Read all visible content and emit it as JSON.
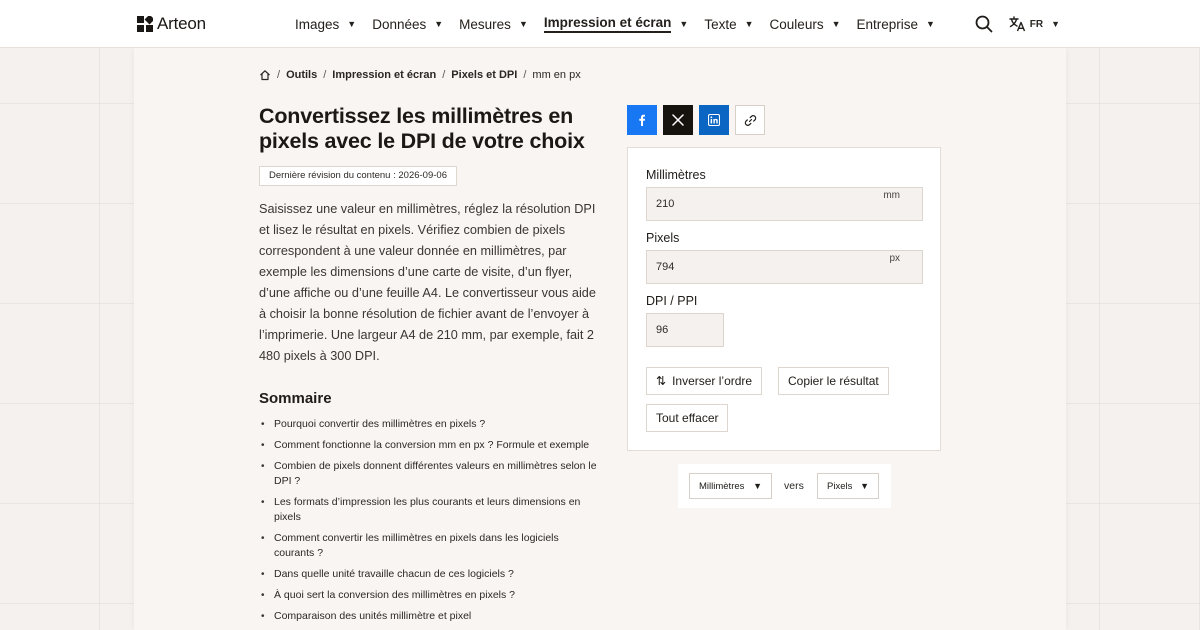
{
  "brand": {
    "name": "Arteon"
  },
  "nav": {
    "items": [
      {
        "label": "Images"
      },
      {
        "label": "Données"
      },
      {
        "label": "Mesures"
      },
      {
        "label": "Impression et écran",
        "active": true
      },
      {
        "label": "Texte"
      },
      {
        "label": "Couleurs"
      },
      {
        "label": "Entreprise"
      }
    ],
    "language": "FR"
  },
  "breadcrumb": [
    "Outils",
    "Impression et écran",
    "Pixels et DPI",
    "mm en px"
  ],
  "article": {
    "title": "Convertissez les millimètres en pixels avec le DPI de votre choix",
    "revision": "Dernière révision du contenu : 2026-09-06",
    "intro": "Saisissez une valeur en millimètres, réglez la résolution DPI et lisez le résultat en pixels. Vérifiez combien de pixels correspondent à une valeur donnée en millimètres, par exemple les dimensions d’une carte de visite, d’un flyer, d’une affiche ou d’une feuille A4. Le convertisseur vous aide à choisir la bonne résolution de fichier avant de l’envoyer à l’imprimerie. Une largeur A4 de 210 mm, par exemple, fait 2 480 pixels à 300 DPI.",
    "summary_title": "Sommaire",
    "toc": [
      "Pourquoi convertir des millimètres en pixels ?",
      "Comment fonctionne la conversion mm en px ? Formule et exemple",
      "Combien de pixels donnent différentes valeurs en millimètres selon le DPI ?",
      "Les formats d’impression les plus courants et leurs dimensions en pixels",
      "Comment convertir les millimètres en pixels dans les logiciels courants ?",
      "Dans quelle unité travaille chacun de ces logiciels ?",
      "À quoi sert la conversion des millimètres en pixels ?",
      "Comparaison des unités millimètre et pixel"
    ]
  },
  "converter": {
    "mm": {
      "label": "Millimètres",
      "value": "210",
      "unit": "mm"
    },
    "px": {
      "label": "Pixels",
      "value": "794",
      "unit": "px"
    },
    "dpi": {
      "label": "DPI / PPI",
      "value": "96"
    },
    "buttons": {
      "swap": "Inverser l’ordre",
      "copy": "Copier le résultat",
      "clear": "Tout effacer"
    }
  },
  "unit_selector": {
    "from": "Millimètres",
    "connector": "vers",
    "to": "Pixels"
  },
  "colors": {
    "facebook": "#1877f2",
    "x": "#16130f",
    "linkedin": "#0a66c2",
    "page_background": "#f4f1ee"
  },
  "icons": {
    "search": "search-icon",
    "language": "translate-icon",
    "home": "home-icon",
    "facebook": "facebook-icon",
    "x": "x-icon",
    "linkedin": "linkedin-icon",
    "link": "link-icon",
    "swap": "swap-icon"
  }
}
